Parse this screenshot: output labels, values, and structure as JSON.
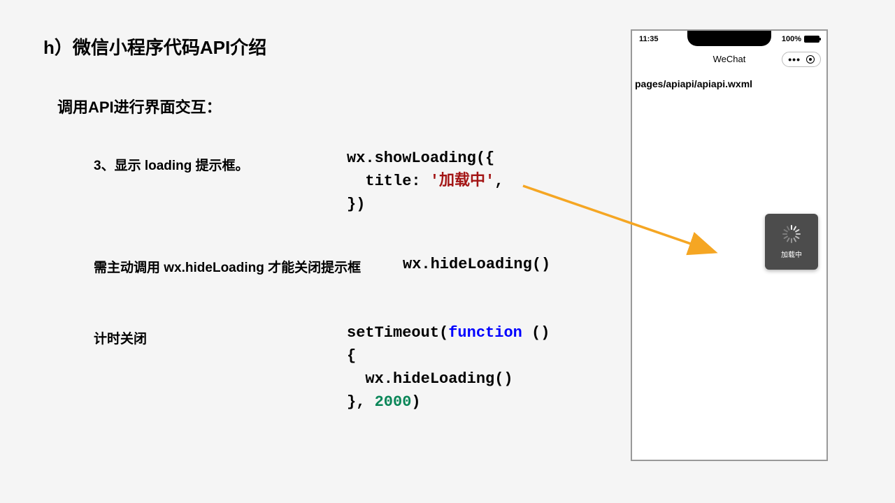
{
  "heading": "h）微信小程序代码API介绍",
  "subheading": "调用API进行界面交互：",
  "point3": "3、显示 loading 提示框。",
  "code1": {
    "line1_pre": "wx.showLoading({",
    "line2_pre": "  title: ",
    "line2_str": "'加载中'",
    "line2_post": ",",
    "line3": "})"
  },
  "pointHide": "需主动调用 wx.hideLoading 才能关闭提示框",
  "code2": "wx.hideLoading()",
  "pointTimer": "计时关闭",
  "code3": {
    "l1a": "setTimeout(",
    "l1b": "function",
    "l1c": " ()",
    "l2": "{",
    "l3": "  wx.hideLoading()",
    "l4a": "}, ",
    "l4b": "2000",
    "l4c": ")"
  },
  "phone": {
    "time": "11:35",
    "battery": "100%",
    "title": "WeChat",
    "path": "pages/apiapi/apiapi.wxml",
    "toast": "加载中"
  }
}
